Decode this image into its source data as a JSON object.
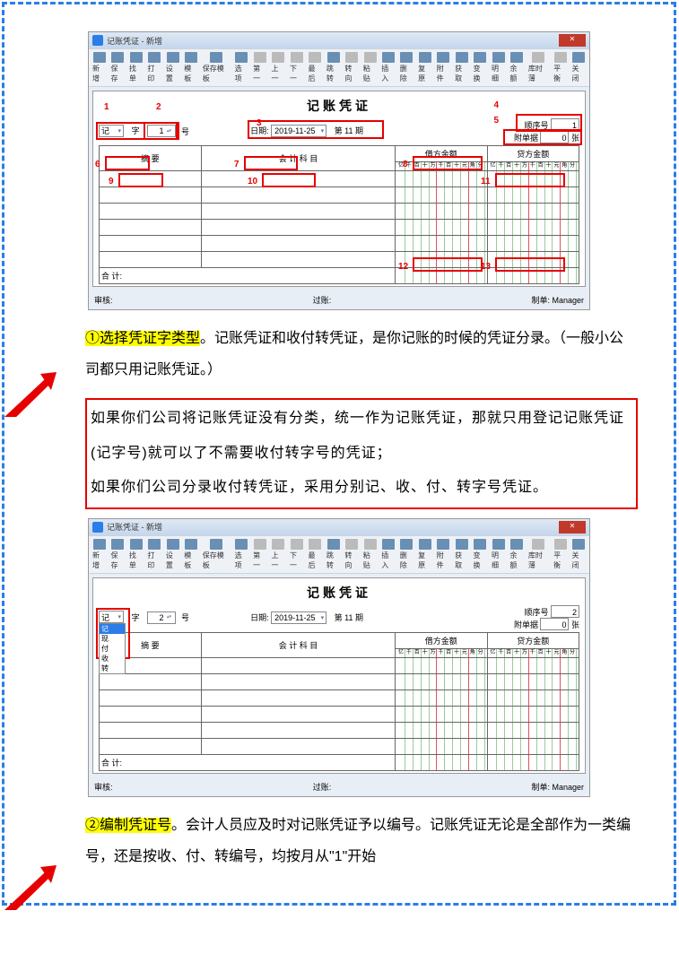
{
  "window_title": "记账凭证 - 新增",
  "toolbar": [
    "新增",
    "保存",
    "找单",
    "打印",
    "设置",
    "模板",
    "保存模板",
    "选项",
    "第一",
    "上一",
    "下一",
    "最后",
    "跳转",
    "转向",
    "粘贴",
    "插入",
    "删除",
    "复原",
    "附件",
    "获取",
    "变换",
    "明细",
    "余额",
    "库时薄",
    "平衡",
    "关闭"
  ],
  "voucher": {
    "title": "记账凭证",
    "type_value": "记",
    "type_suffix": "字",
    "no_value_1": "1",
    "no_value_2": "2",
    "no_suffix": "号",
    "date_label": "日期:",
    "date_value": "2019-11-25",
    "period": "第 11 期",
    "seq_label": "顺序号",
    "seq_value_1": "1",
    "seq_value_2": "2",
    "attach_label": "附单据",
    "attach_value": "0",
    "attach_suffix": "张",
    "col_summary": "摘   要",
    "col_subject": "会 计 科 目",
    "col_debit": "借方金额",
    "col_credit": "贷方金额",
    "units": [
      "亿",
      "千",
      "百",
      "十",
      "万",
      "千",
      "百",
      "十",
      "元",
      "角",
      "分"
    ],
    "total_label": "合  计:",
    "footer_审核": "审核:",
    "footer_过账": "过账:",
    "footer_制单": "制单:",
    "footer_制单_val": "Manager",
    "dropdown_options": [
      "记",
      "现",
      "付",
      "收",
      "转"
    ]
  },
  "labels": {
    "l1": "1",
    "l2": "2",
    "l3": "3",
    "l4": "4",
    "l5": "5",
    "l6": "6",
    "l7": "7",
    "l8": "8",
    "l9": "9",
    "l10": "10",
    "l11": "11",
    "l12": "12",
    "l13": "13"
  },
  "para1_h": "①选择凭证字类型",
  "para1_a": "。记账凭证和收付转凭证，是你记账的时候的凭证分录。（一般小公司都只用记账凭证。）",
  "para2_a": "如果你们公司将记账凭证没有分类，统一作为记账凭证，那就只用登记记账凭证(记字号)就可以了不需要收付转字号的凭证；",
  "para2_b": "如果你们公司分录收付转凭证，采用分别记、收、付、转字号凭证。",
  "para3_h": "②编制凭证号",
  "para3_a": "。会计人员应及时对记账凭证予以编号。记账凭证无论是全部作为一类编号，还是按收、付、转编号，均按月从\"1\"开始"
}
